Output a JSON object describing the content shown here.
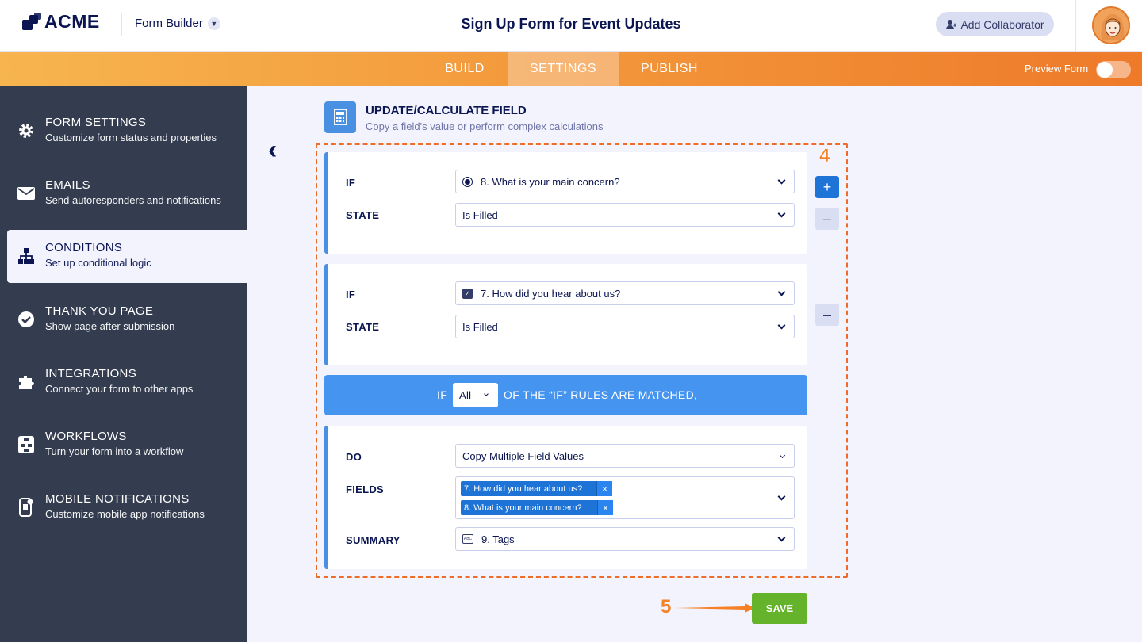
{
  "header": {
    "logo": "ACME",
    "builder_label": "Form Builder",
    "form_title": "Sign Up Form for Event Updates",
    "collab_label": "Add Collaborator"
  },
  "nav": {
    "tabs": [
      "BUILD",
      "SETTINGS",
      "PUBLISH"
    ],
    "active_tab": "SETTINGS",
    "preview_label": "Preview Form",
    "preview_on": false
  },
  "sidebar": {
    "items": [
      {
        "icon": "gear-icon",
        "title": "FORM SETTINGS",
        "sub": "Customize form status and properties"
      },
      {
        "icon": "envelope-icon",
        "title": "EMAILS",
        "sub": "Send autoresponders and notifications"
      },
      {
        "icon": "sitemap-icon",
        "title": "CONDITIONS",
        "sub": "Set up conditional logic"
      },
      {
        "icon": "check-circle-icon",
        "title": "THANK YOU PAGE",
        "sub": "Show page after submission"
      },
      {
        "icon": "puzzle-icon",
        "title": "INTEGRATIONS",
        "sub": "Connect your form to other apps"
      },
      {
        "icon": "workflow-icon",
        "title": "WORKFLOWS",
        "sub": "Turn your form into a workflow"
      },
      {
        "icon": "mobile-icon",
        "title": "MOBILE NOTIFICATIONS",
        "sub": "Customize mobile app notifications"
      }
    ],
    "active": "CONDITIONS"
  },
  "panel": {
    "title": "UPDATE/CALCULATE FIELD",
    "subtitle": "Copy a field's value or perform complex calculations"
  },
  "conditions": [
    {
      "if_label": "IF",
      "field": "8. What is your main concern?",
      "field_icon": "radio-icon",
      "state_label": "STATE",
      "state": "Is Filled"
    },
    {
      "if_label": "IF",
      "field": "7. How did you hear about us?",
      "field_icon": "checkbox-icon",
      "state_label": "STATE",
      "state": "Is Filled"
    }
  ],
  "match": {
    "if_label": "IF",
    "value": "All",
    "text": "OF THE “IF” RULES ARE MATCHED,"
  },
  "action": {
    "do_label": "DO",
    "do_value": "Copy Multiple Field Values",
    "fields_label": "FIELDS",
    "fields": [
      "7. How did you hear about us?",
      "8. What is your main concern?"
    ],
    "summary_label": "SUMMARY",
    "summary_value": "9. Tags"
  },
  "annotations": {
    "step4": "4",
    "step5": "5",
    "color": "#f58026"
  },
  "save_label": "SAVE",
  "colors": {
    "accent_blue": "#4a90e2",
    "save_green": "#64b32b",
    "sidebar_bg": "#343c4f",
    "nav_orange": "#f39a3c"
  }
}
